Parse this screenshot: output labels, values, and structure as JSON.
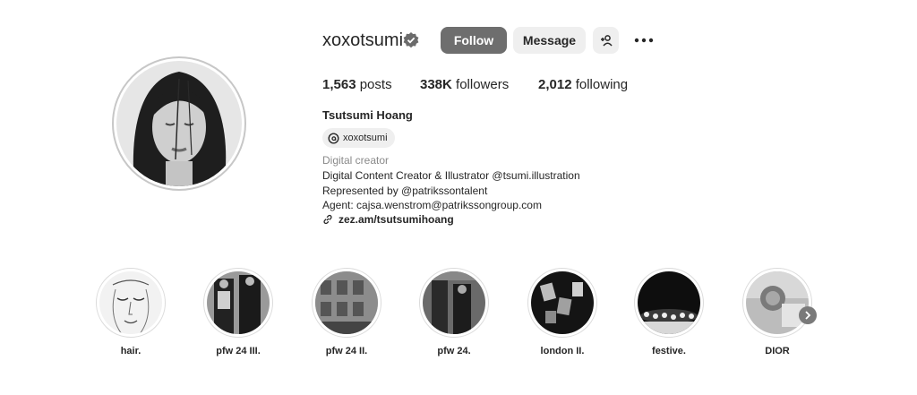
{
  "profile": {
    "username": "xoxotsumi",
    "full_name": "Tsutsumi Hoang",
    "threads_handle": "xoxotsumi",
    "category": "Digital creator",
    "bio_lines": [
      "Digital Content Creator & Illustrator @tsumi.illustration",
      "Represented by @patrikssontalent",
      "Agent: cajsa.wenstrom@patrikssongroup.com"
    ],
    "link": "zez.am/tsutsumihoang"
  },
  "actions": {
    "follow": "Follow",
    "message": "Message",
    "add_user_icon": "person-add-icon",
    "more_icon": "more-horizontal-icon"
  },
  "stats": {
    "posts_value": "1,563",
    "posts_label": "posts",
    "followers_value": "338K",
    "followers_label": "followers",
    "following_value": "2,012",
    "following_label": "following"
  },
  "highlights": [
    {
      "label": "hair."
    },
    {
      "label": "pfw 24 III."
    },
    {
      "label": "pfw 24 II."
    },
    {
      "label": "pfw 24."
    },
    {
      "label": "london II."
    },
    {
      "label": "festive."
    },
    {
      "label": "DIOR"
    }
  ],
  "colors": {
    "follow_bg": "#6e6e6e",
    "secondary_btn_bg": "#efefef",
    "text": "#262626",
    "muted": "#8a8a8a"
  }
}
